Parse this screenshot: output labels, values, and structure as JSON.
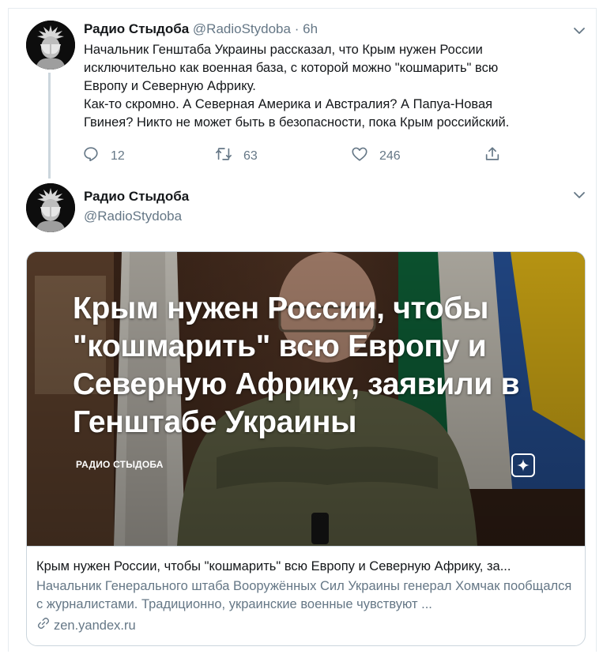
{
  "tweet1": {
    "name": "Радио Стыдоба",
    "handle": "@RadioStydoba",
    "separator": "·",
    "time": "6h",
    "text_lines": [
      "Начальник Генштаба Украины рассказал, что Крым нужен России",
      "исключительно как военная база, с которой можно \"кошмарить\" всю",
      "Европу и Северную Африку.",
      "Как-то скромно. А Северная Америка и Австралия? А Папуа-Новая",
      "Гвинея? Никто не может быть в безопасности, пока Крым российский."
    ],
    "actions": {
      "reply_count": "12",
      "retweet_count": "63",
      "like_count": "246"
    }
  },
  "tweet2": {
    "name": "Радио Стыдоба",
    "handle": "@RadioStydoba",
    "card": {
      "image_headline": "Крым нужен России, чтобы \"кошмарить\" всю Европу и Северную Африку, заявили в Генштабе Украины",
      "image_source": "РАДИО СТЫДОБА",
      "title": "Крым нужен России, чтобы \"кошмарить\" всю Европу и Северную Африку, за...",
      "description": "Начальник Генерального штаба Вооружённых Сил Украины генерал Хомчак пообщался с журналистами. Традиционно, украинские военные чувствуют ...",
      "domain": "zen.yandex.ru"
    }
  },
  "icons": [
    "caret-down-icon",
    "reply-icon",
    "retweet-icon",
    "like-icon",
    "share-icon",
    "link-icon",
    "zen-logo-icon"
  ],
  "colors": {
    "text_primary": "#14171a",
    "text_secondary": "#657786",
    "border": "#ccd6dd",
    "flag_blue": "#2a5aa8",
    "flag_yellow": "#f2c418"
  }
}
